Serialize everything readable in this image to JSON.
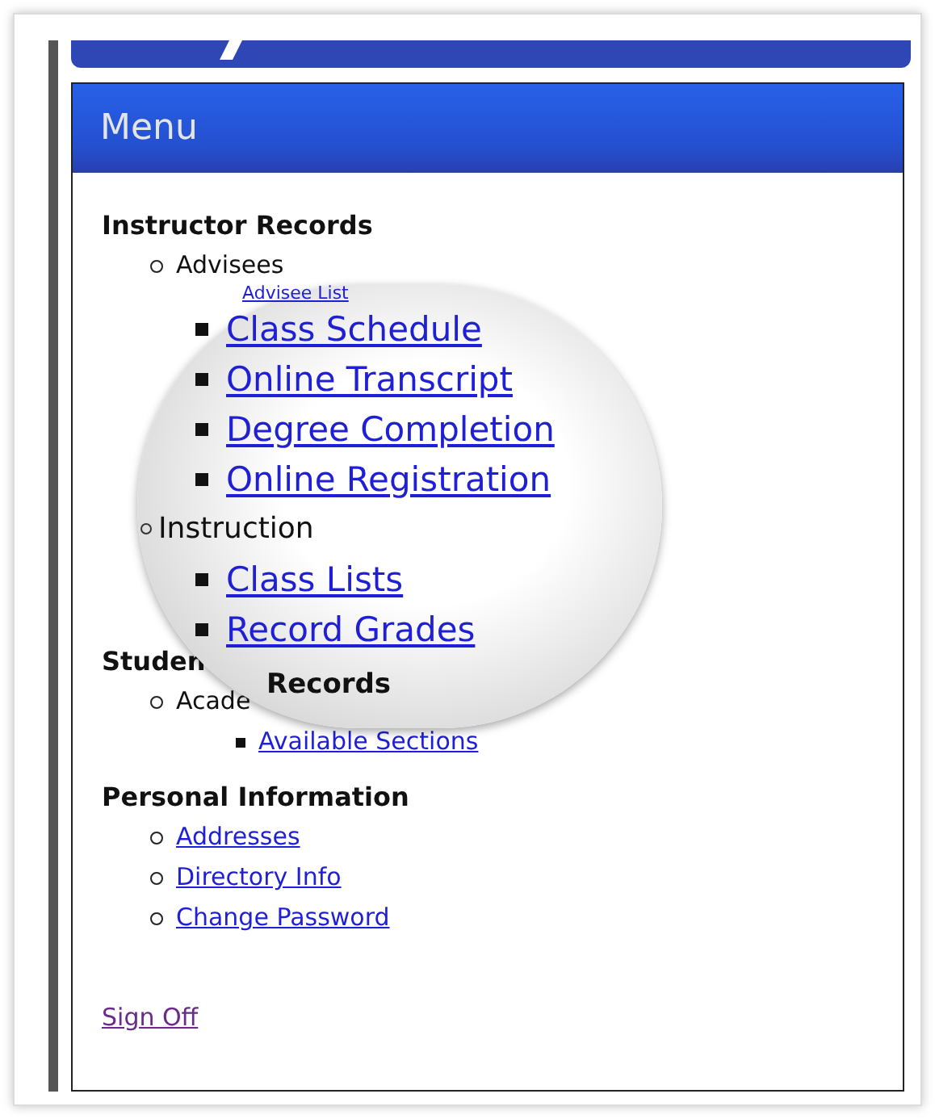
{
  "menu_title": "Menu",
  "sections": [
    {
      "heading": "Instructor Records",
      "items": [
        {
          "label": "Advisees",
          "kind": "group"
        }
      ]
    },
    {
      "heading": "Studen",
      "items": [
        {
          "label": "Acade",
          "kind": "group",
          "children": [
            {
              "label": "Available Sections",
              "kind": "link"
            }
          ]
        }
      ]
    },
    {
      "heading": "Personal Information",
      "items": [
        {
          "label": "Addresses",
          "kind": "link"
        },
        {
          "label": "Directory Info",
          "kind": "link"
        },
        {
          "label": "Change Password",
          "kind": "link"
        }
      ]
    }
  ],
  "magnifier": {
    "items": [
      {
        "label": "Advisee List",
        "kind": "small_link"
      },
      {
        "label": "Class Schedule",
        "kind": "link"
      },
      {
        "label": "Online Transcript",
        "kind": "link"
      },
      {
        "label": "Degree Completion",
        "kind": "link"
      },
      {
        "label": "Online Registration",
        "kind": "link"
      },
      {
        "label": "Instruction",
        "kind": "group"
      },
      {
        "label": "Class Lists",
        "kind": "link"
      },
      {
        "label": "Record Grades",
        "kind": "link"
      },
      {
        "label": "Records",
        "kind": "heading"
      }
    ]
  },
  "sign_off": "Sign Off"
}
